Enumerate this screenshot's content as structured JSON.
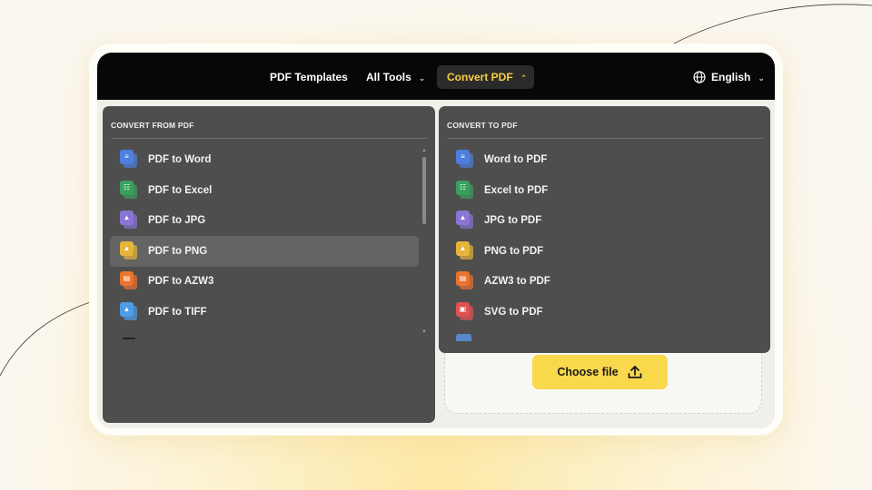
{
  "navbar": {
    "templates_label": "PDF Templates",
    "alltools_label": "All Tools",
    "convert_label": "Convert PDF",
    "language_label": "English"
  },
  "convert_from": {
    "heading": "CONVERT FROM PDF",
    "items": [
      {
        "label": "PDF to Word",
        "color": "#4f7fdc",
        "icon": "document-icon"
      },
      {
        "label": "PDF to Excel",
        "color": "#3aa05e",
        "icon": "spreadsheet-icon"
      },
      {
        "label": "PDF to JPG",
        "color": "#8a74d4",
        "icon": "image-icon"
      },
      {
        "label": "PDF to PNG",
        "color": "#e6b43a",
        "icon": "image-icon"
      },
      {
        "label": "PDF to AZW3",
        "color": "#e8742e",
        "icon": "book-icon"
      },
      {
        "label": "PDF to TIFF",
        "color": "#4c9ce8",
        "icon": "image-icon"
      }
    ],
    "active_index": 3
  },
  "convert_to": {
    "heading": "CONVERT TO PDF",
    "items": [
      {
        "label": "Word to PDF",
        "color": "#4f7fdc",
        "icon": "document-icon"
      },
      {
        "label": "Excel to PDF",
        "color": "#3aa05e",
        "icon": "spreadsheet-icon"
      },
      {
        "label": "JPG to PDF",
        "color": "#8a74d4",
        "icon": "image-icon"
      },
      {
        "label": "PNG to PDF",
        "color": "#e6b43a",
        "icon": "image-icon"
      },
      {
        "label": "AZW3 to PDF",
        "color": "#e8742e",
        "icon": "book-icon"
      },
      {
        "label": "SVG to PDF",
        "color": "#e05252",
        "icon": "vector-icon"
      }
    ]
  },
  "upload": {
    "button_label": "Choose file"
  },
  "colors": {
    "accent": "#f9d84b",
    "navbar": "#070707",
    "panel": "#4e4e4e",
    "highlight": "#f6cf3f"
  }
}
